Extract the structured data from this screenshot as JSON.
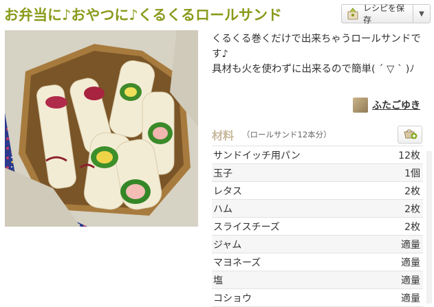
{
  "recipe": {
    "title": "お弁当に♪おやつに♪くるくるロールサンド",
    "save_button_label": "レシピを保存",
    "description": "くるくる巻くだけで出来ちゃうロールサンドです♪\n具材も火を使わずに出来るので簡単( ´ ▽ ` )ﾉ",
    "author": "ふたごゆき"
  },
  "ingredients": {
    "heading": "材料",
    "serving": "（ロールサンド12本分）",
    "items": [
      {
        "name": "サンドイッチ用パン",
        "qty": "12枚"
      },
      {
        "name": "玉子",
        "qty": "1個"
      },
      {
        "name": "レタス",
        "qty": "2枚"
      },
      {
        "name": "ハム",
        "qty": "2枚"
      },
      {
        "name": "スライスチーズ",
        "qty": "2枚"
      },
      {
        "name": "ジャム",
        "qty": "適量"
      },
      {
        "name": "マヨネーズ",
        "qty": "適量"
      },
      {
        "name": "塩",
        "qty": "適量"
      },
      {
        "name": "コショウ",
        "qty": "適量"
      }
    ]
  },
  "colors": {
    "title": "#8a9a1a",
    "ingredient_heading": "#c8b99c"
  },
  "icons": {
    "save": "recipe-save-icon",
    "dropdown": "chevron-down-icon",
    "basket": "shopping-basket-icon"
  }
}
